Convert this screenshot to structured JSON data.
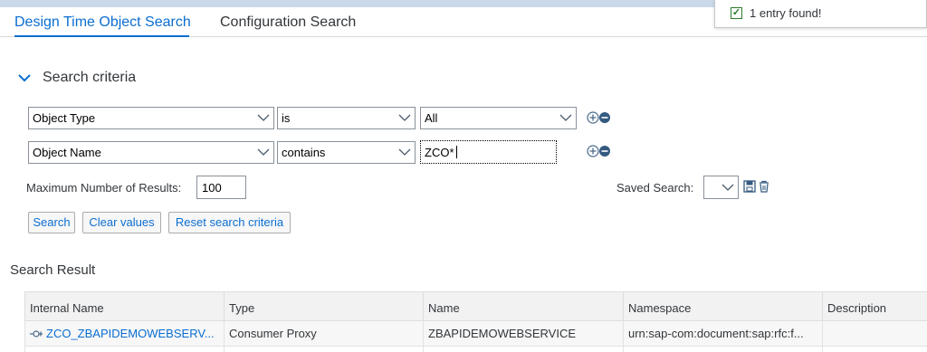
{
  "tabs": {
    "design_time": "Design Time Object Search",
    "configuration": "Configuration Search"
  },
  "toast": {
    "message": "1 entry found!"
  },
  "search_criteria": {
    "title": "Search criteria",
    "rows": [
      {
        "field": "Object Type",
        "operator": "is",
        "value": "All"
      },
      {
        "field": "Object Name",
        "operator": "contains",
        "value": "ZCO*"
      }
    ],
    "max_results_label": "Maximum Number of Results:",
    "max_results_value": "100",
    "saved_search_label": "Saved Search:",
    "buttons": {
      "search": "Search",
      "clear": "Clear values",
      "reset": "Reset search criteria"
    }
  },
  "results": {
    "title": "Search Result",
    "columns": [
      "Internal Name",
      "Type",
      "Name",
      "Namespace",
      "Description"
    ],
    "rows": [
      {
        "internal_name": "ZCO_ZBAPIDEMOWEBSERV...",
        "type": "Consumer Proxy",
        "name": "ZBAPIDEMOWEBSERVICE",
        "namespace": "urn:sap-com:document:sap:rfc:f...",
        "description": ""
      }
    ]
  },
  "colors": {
    "accent": "#0a6ed1",
    "success": "#2b7c2b"
  }
}
